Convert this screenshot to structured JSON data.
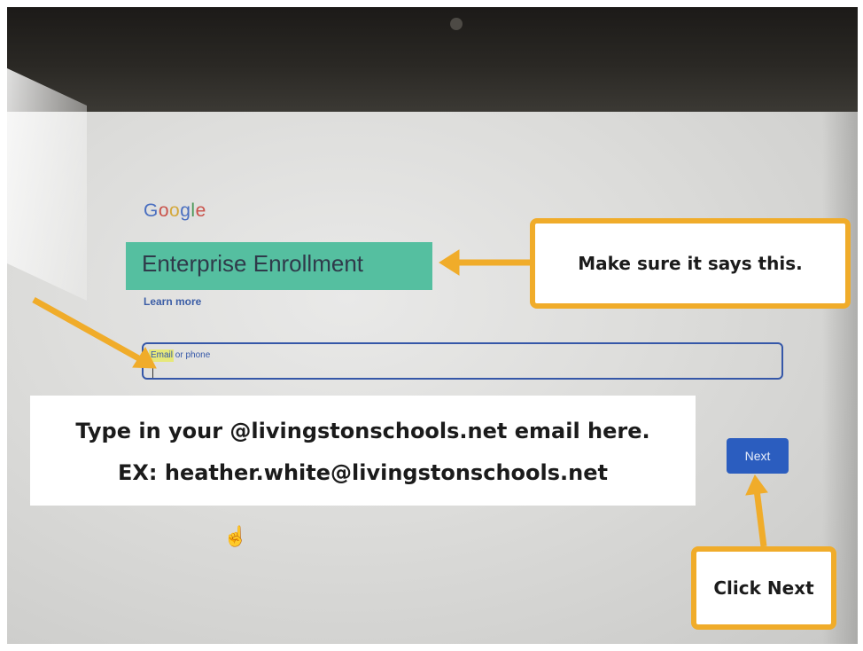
{
  "google_logo": [
    "G",
    "o",
    "o",
    "g",
    "l",
    "e"
  ],
  "enrollment": {
    "title": "Enterprise Enrollment",
    "learn_more": "Learn more"
  },
  "email": {
    "label_highlighted": "Email",
    "label_rest": " or phone",
    "value": ""
  },
  "next_button": "Next",
  "annotations": {
    "top_callout": "Make sure it says this.",
    "instruction_line1": "Type in your @livingstonschools.net email here.",
    "instruction_line2": "EX: heather.white@livingstonschools.net",
    "next_callout": "Click Next"
  },
  "colors": {
    "highlight": "#55bfa0",
    "callout_border": "#f0ac2a",
    "button": "#2b5dbf",
    "input_border": "#3557a8"
  },
  "icons": {
    "cursor": "hand-pointer-icon"
  }
}
